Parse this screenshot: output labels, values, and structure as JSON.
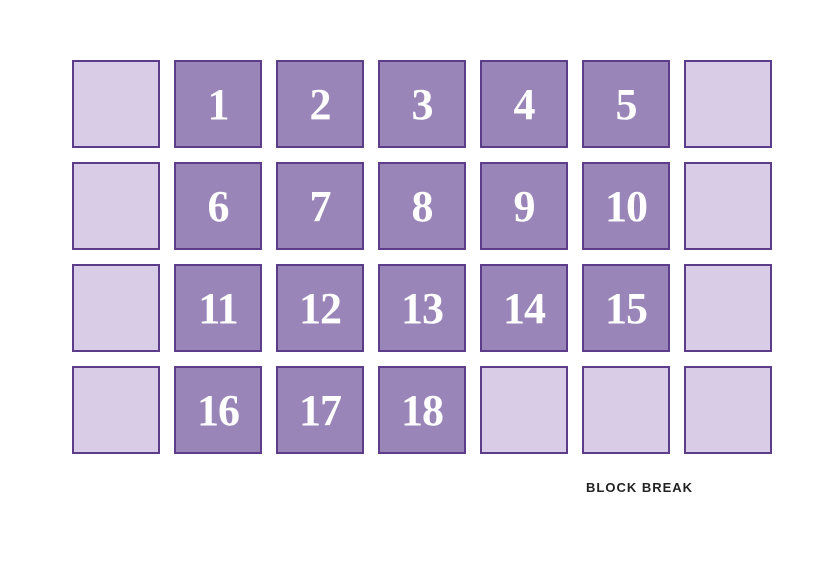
{
  "caption": "BLOCK BREAK",
  "grid": {
    "rows": 4,
    "cols": 7,
    "cells": [
      [
        null,
        "1",
        "2",
        "3",
        "4",
        "5",
        null
      ],
      [
        null,
        "6",
        "7",
        "8",
        "9",
        "10",
        null
      ],
      [
        null,
        "11",
        "12",
        "13",
        "14",
        "15",
        null
      ],
      [
        null,
        "16",
        "17",
        "18",
        null,
        null,
        null
      ]
    ]
  },
  "colors": {
    "border": "#5b3d8a",
    "empty_fill": "#d9cce6",
    "numbered_fill": "#9a85b8",
    "number_text": "#ffffff"
  }
}
